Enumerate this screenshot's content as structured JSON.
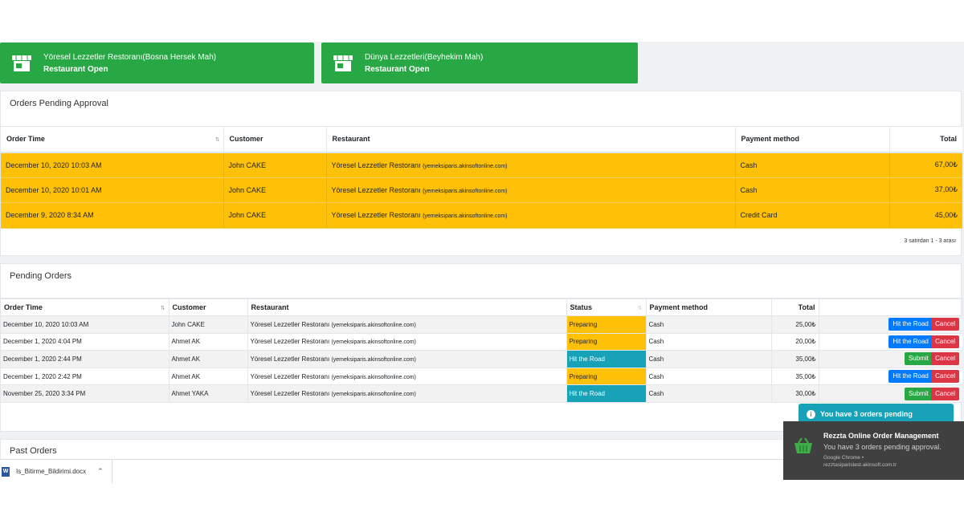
{
  "restaurants": [
    {
      "name": "Yöresel Lezzetler Restoranı(Bosna Hersek Mah)",
      "status": "Restaurant Open"
    },
    {
      "name": "Dünya Lezzetleri(Beyhekim Mah)",
      "status": "Restaurant Open"
    }
  ],
  "pending_approval": {
    "title": "Orders Pending Approval",
    "columns": [
      "Order Time",
      "Customer",
      "Restaurant",
      "Payment method",
      "Total"
    ],
    "rows": [
      {
        "time": "December 10, 2020 10:03 AM",
        "customer": "John CAKE",
        "restaurant": "Yöresel Lezzetler Restoranı",
        "domain": "(yemeksiparis.akinsoftonline.com)",
        "payment": "Cash",
        "total": "67,00₺"
      },
      {
        "time": "December 10, 2020 10:01 AM",
        "customer": "John CAKE",
        "restaurant": "Yöresel Lezzetler Restoranı",
        "domain": "(yemeksiparis.akinsoftonline.com)",
        "payment": "Cash",
        "total": "37,00₺"
      },
      {
        "time": "December 9, 2020 8:34 AM",
        "customer": "John CAKE",
        "restaurant": "Yöresel Lezzetler Restoranı",
        "domain": "(yemeksiparis.akinsoftonline.com)",
        "payment": "Credit Card",
        "total": "45,00₺"
      }
    ],
    "pager": "3 satırdan 1 - 3 arası"
  },
  "pending_orders": {
    "title": "Pending Orders",
    "columns": [
      "Order Time",
      "Customer",
      "Restaurant",
      "Status",
      "Payment method",
      "Total"
    ],
    "rows": [
      {
        "time": "December 10, 2020 10:03 AM",
        "customer": "John CAKE",
        "restaurant": "Yöresel Lezzetler Restoranı",
        "domain": "(yemeksiparis.akinsoftonline.com)",
        "status": "Preparing",
        "payment": "Cash",
        "total": "25,00₺",
        "action": "Hit the Road",
        "cancel": "Cancel"
      },
      {
        "time": "December 1, 2020 4:04 PM",
        "customer": "Ahmet AK",
        "restaurant": "Yöresel Lezzetler Restoranı",
        "domain": "(yemeksiparis.akinsoftonline.com)",
        "status": "Preparing",
        "payment": "Cash",
        "total": "20,00₺",
        "action": "Hit the Road",
        "cancel": "Cancel"
      },
      {
        "time": "December 1, 2020 2:44 PM",
        "customer": "Ahmet AK",
        "restaurant": "Yöresel Lezzetler Restoranı",
        "domain": "(yemeksiparis.akinsoftonline.com)",
        "status": "Hit the Road",
        "payment": "Cash",
        "total": "35,00₺",
        "action": "Submit",
        "cancel": "Cancel"
      },
      {
        "time": "December 1, 2020 2:42 PM",
        "customer": "Ahmet AK",
        "restaurant": "Yöresel Lezzetler Restoranı",
        "domain": "(yemeksiparis.akinsoftonline.com)",
        "status": "Preparing",
        "payment": "Cash",
        "total": "35,00₺",
        "action": "Hit the Road",
        "cancel": "Cancel"
      },
      {
        "time": "November 25, 2020 3:34 PM",
        "customer": "Ahmet YAKA",
        "restaurant": "Yöresel Lezzetler Restoranı",
        "domain": "(yemeksiparis.akinsoftonline.com)",
        "status": "Hit the Road",
        "payment": "Cash",
        "total": "30,00₺",
        "action": "Submit",
        "cancel": "Cancel"
      }
    ]
  },
  "past_orders": {
    "title": "Past Orders"
  },
  "toast": {
    "text": "You have 3 orders pending"
  },
  "notification": {
    "title": "Rezzta Online Order Management",
    "message": "You have 3 orders pending approval.",
    "source_line1": "Google Chrome •",
    "source_line2": "rezztasiparistest.akinsoft.com.tr"
  },
  "download": {
    "filename": "Is_Bitirme_Bildirimi.docx"
  },
  "colors": {
    "green": "#28a745",
    "amber": "#ffc107",
    "teal": "#17a2b8",
    "blue": "#007bff",
    "red": "#dc3545"
  }
}
